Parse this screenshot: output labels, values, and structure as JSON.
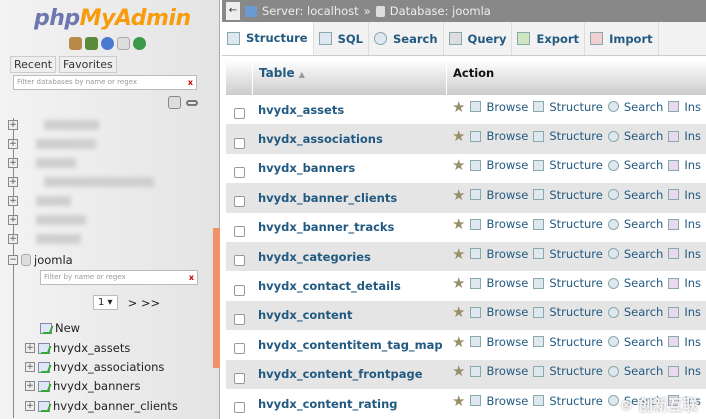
{
  "sidebar": {
    "logo_php": "php",
    "logo_myadmin": "MyAdmin",
    "tabs": [
      "Recent",
      "Favorites"
    ],
    "db_filter_placeholder": "Filter databases by name or regex",
    "clear": "x",
    "db": "joomla",
    "table_filter_placeholder": "Filter by name or regex",
    "page": "1",
    "page_nav": "> >>",
    "new_label": "New",
    "tables": [
      "hvydx_assets",
      "hvydx_associations",
      "hvydx_banners",
      "hvydx_banner_clients"
    ]
  },
  "breadcrumb": {
    "back": "←",
    "server": "Server: localhost",
    "sep": "»",
    "database": "Database: joomla"
  },
  "tabs": [
    "Structure",
    "SQL",
    "Search",
    "Query",
    "Export",
    "Import"
  ],
  "table": {
    "col_table": "Table",
    "sort": "▲",
    "col_action": "Action",
    "actions": [
      "Browse",
      "Structure",
      "Search",
      "Ins"
    ],
    "rows": [
      "hvydx_assets",
      "hvydx_associations",
      "hvydx_banners",
      "hvydx_banner_clients",
      "hvydx_banner_tracks",
      "hvydx_categories",
      "hvydx_contact_details",
      "hvydx_content",
      "hvydx_contentitem_tag_map",
      "hvydx_content_frontpage",
      "hvydx_content_rating"
    ]
  },
  "watermark": "创新互联"
}
